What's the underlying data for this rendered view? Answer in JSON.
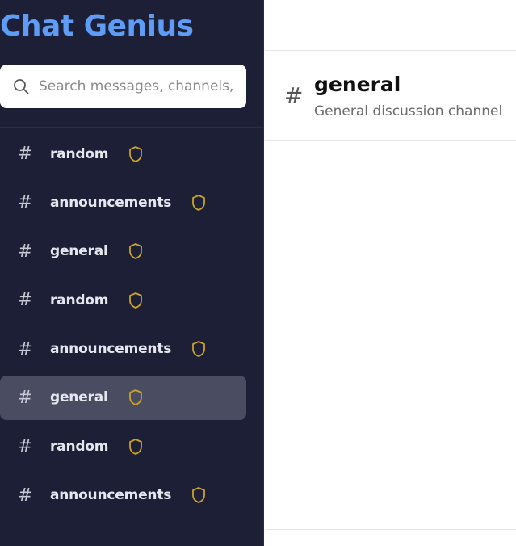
{
  "app": {
    "title": "Chat Genius"
  },
  "search": {
    "placeholder": "Search messages, channels, a"
  },
  "sidebar": {
    "channels": [
      {
        "name": "random",
        "active": false
      },
      {
        "name": "announcements",
        "active": false
      },
      {
        "name": "general",
        "active": false
      },
      {
        "name": "random",
        "active": false
      },
      {
        "name": "announcements",
        "active": false
      },
      {
        "name": "general",
        "active": true
      },
      {
        "name": "random",
        "active": false
      },
      {
        "name": "announcements",
        "active": false
      }
    ]
  },
  "channel_header": {
    "hash": "#",
    "title": "general",
    "description": "General discussion channel"
  },
  "icons": {
    "hash": "hash-icon",
    "shield": "shield-icon",
    "search": "search-icon"
  },
  "colors": {
    "sidebar_bg": "#1c1f36",
    "title_blue": "#5e9cf5",
    "shield_gold": "#c9a227",
    "active_bg": "#4a4d62"
  }
}
